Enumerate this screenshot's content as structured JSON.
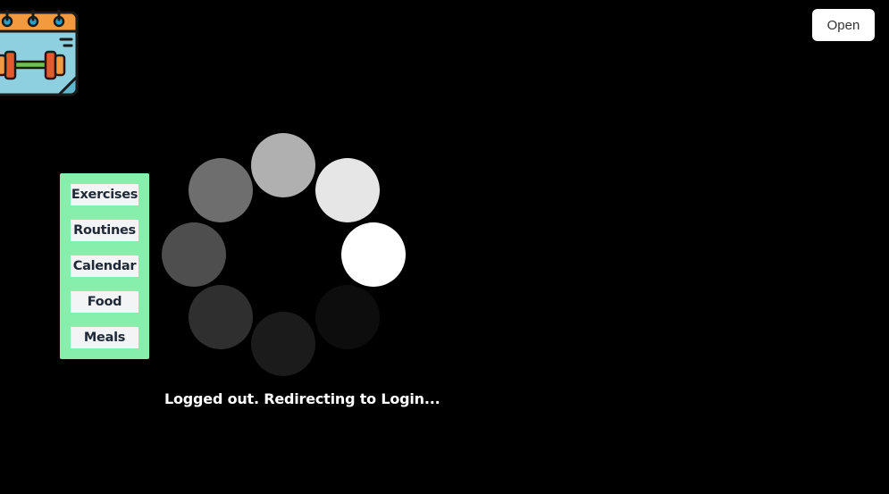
{
  "header": {
    "logo_icon": "calendar-dumbbell-icon",
    "open_label": "Open"
  },
  "nav": {
    "items": [
      {
        "label": "Exercises"
      },
      {
        "label": "Routines"
      },
      {
        "label": "Calendar"
      },
      {
        "label": "Food"
      },
      {
        "label": "Meals"
      }
    ]
  },
  "spinner": {
    "icon": "loading-spinner-icon",
    "dot_colors": [
      "#ffffff",
      "#0d0d0d",
      "#1b1b1b",
      "#2f2f2f",
      "#4e4e4e",
      "#6e6e6e",
      "#b0b0b0",
      "#e6e6e6"
    ]
  },
  "status": {
    "message": "Logged out. Redirecting to Login..."
  },
  "colors": {
    "background": "#000000",
    "nav_panel": "#86efac",
    "nav_button": "#f3f4f6",
    "open_button": "#ffffff"
  }
}
